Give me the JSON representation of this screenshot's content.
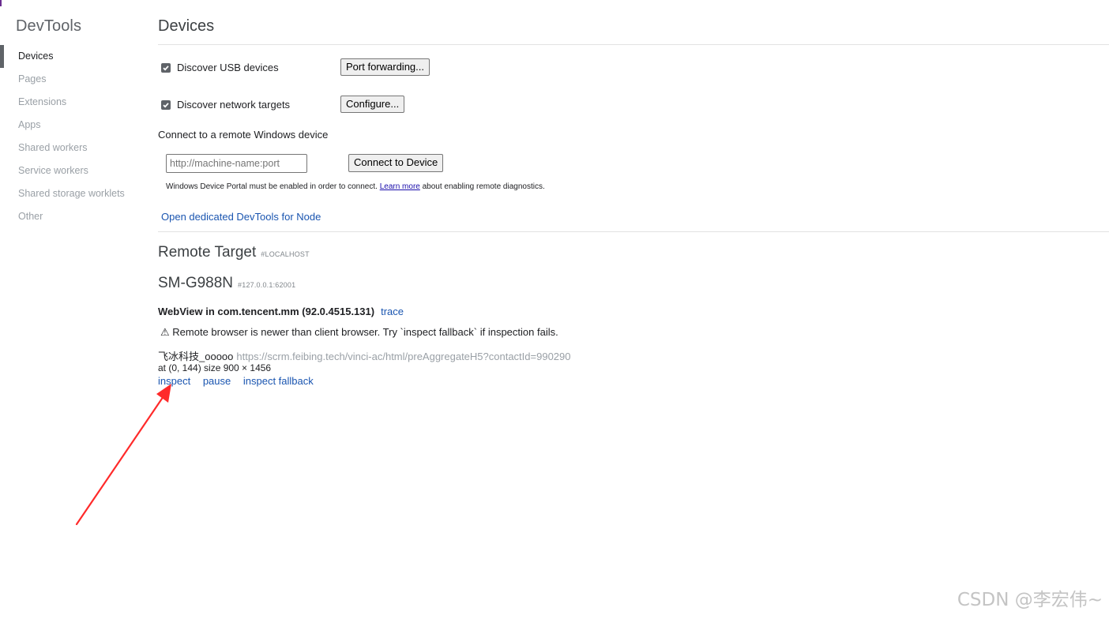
{
  "sidebar": {
    "title": "DevTools",
    "items": [
      {
        "label": "Devices",
        "selected": true
      },
      {
        "label": "Pages"
      },
      {
        "label": "Extensions"
      },
      {
        "label": "Apps"
      },
      {
        "label": "Shared workers"
      },
      {
        "label": "Service workers"
      },
      {
        "label": "Shared storage worklets"
      },
      {
        "label": "Other"
      }
    ]
  },
  "devices": {
    "title": "Devices",
    "discover_usb_label": "Discover USB devices",
    "discover_usb_checked": true,
    "port_forwarding_label": "Port forwarding...",
    "discover_network_label": "Discover network targets",
    "discover_network_checked": true,
    "configure_label": "Configure...",
    "remote_windows_label": "Connect to a remote Windows device",
    "remote_input_placeholder": "http://machine-name:port",
    "connect_button_label": "Connect to Device",
    "portal_note_prefix": "Windows Device Portal must be enabled in order to connect.",
    "learn_more_label": "Learn more",
    "portal_note_suffix": "about enabling remote diagnostics.",
    "node_link_label": "Open dedicated DevTools for Node"
  },
  "remote": {
    "title": "Remote Target",
    "title_tag": "#LOCALHOST",
    "device_name": "SM-G988N",
    "device_tag": "#127.0.0.1:62001",
    "webview_label": "WebView in com.tencent.mm (92.0.4515.131)",
    "trace_label": "trace",
    "warning_icon": "⚠",
    "warning_text": "Remote browser is newer than client browser. Try `inspect fallback` if inspection fails.",
    "page_title": "飞冰科技_ooooo",
    "page_url": "https://scrm.feibing.tech/vinci-ac/html/preAggregateH5?contactId=990290",
    "page_position": "at (0, 144)  size 900 × 1456",
    "actions": {
      "inspect": "inspect",
      "pause": "pause",
      "inspect_fallback": "inspect fallback"
    }
  },
  "annotation": {
    "arrow_color": "#ff2a2a"
  },
  "watermark": "CSDN @李宏伟~"
}
